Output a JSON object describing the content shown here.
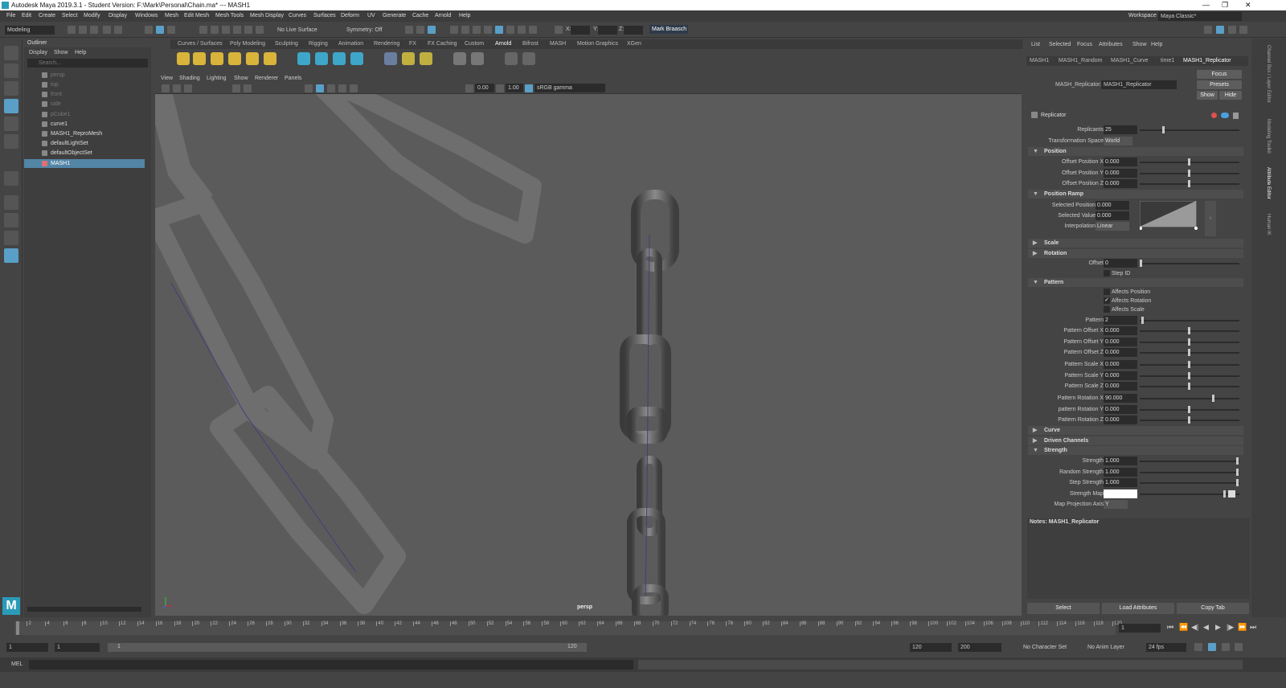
{
  "titlebar": {
    "title": "Autodesk Maya 2019.3.1 - Student Version: F:\\Mark\\Personal\\Chain.ma*   ---   MASH1",
    "min": "—",
    "max": "❐",
    "close": "✕"
  },
  "menu": [
    "File",
    "Edit",
    "Create",
    "Select",
    "Modify",
    "Display",
    "Windows",
    "Mesh",
    "Edit Mesh",
    "Mesh Tools",
    "Mesh Display",
    "Curves",
    "Surfaces",
    "Deform",
    "UV",
    "Generate",
    "Cache",
    "Arnold",
    "Help"
  ],
  "workspace": {
    "label": "Workspace :",
    "value": "Maya Classic*"
  },
  "status": {
    "mode": "Modeling",
    "live": "No Live Surface",
    "symmetry": "Symmetry: Off",
    "x_label": "X:",
    "y_label": "Y:",
    "z_label": "Z:",
    "user": "Mark Braasch"
  },
  "shelf_tabs": [
    "Curves / Surfaces",
    "Poly Modeling",
    "Sculpting",
    "Rigging",
    "Animation",
    "Rendering",
    "FX",
    "FX Caching",
    "Custom",
    "Arnold",
    "Bifrost",
    "MASH",
    "Motion Graphics",
    "XGen"
  ],
  "shelf_active": "Arnold",
  "outliner": {
    "title": "Outliner",
    "menu": [
      "Display",
      "Show",
      "Help"
    ],
    "search": "Search...",
    "items": [
      {
        "label": "persp",
        "dim": true
      },
      {
        "label": "top",
        "dim": true
      },
      {
        "label": "front",
        "dim": true
      },
      {
        "label": "side",
        "dim": true
      },
      {
        "label": "pCube1",
        "dim": true
      },
      {
        "label": "curve1",
        "dim": false
      },
      {
        "label": "MASH1_ReproMesh",
        "dim": false
      },
      {
        "label": "defaultLightSet",
        "dim": false
      },
      {
        "label": "defaultObjectSet",
        "dim": false
      },
      {
        "label": "MASH1",
        "dim": false,
        "selected": true
      }
    ]
  },
  "viewport": {
    "menu": [
      "View",
      "Shading",
      "Lighting",
      "Show",
      "Renderer",
      "Panels"
    ],
    "exposure": "0.00",
    "gamma": "1.00",
    "colorspace": "sRGB gamma",
    "camera": "persp"
  },
  "attr_editor": {
    "menu": [
      "List",
      "Selected",
      "Focus",
      "Attributes",
      "Show",
      "Help"
    ],
    "tabs": [
      "MASH1",
      "MASH1_Random",
      "MASH1_Curve",
      "time1",
      "MASH1_Replicator"
    ],
    "active_tab": "MASH1_Replicator",
    "node_label": "MASH_Replicator:",
    "node_value": "MASH1_Replicator",
    "btn_focus": "Focus",
    "btn_presets": "Presets",
    "btn_show": "Show",
    "btn_hide": "Hide",
    "header": "Replicator",
    "replicants_label": "Replicants",
    "replicants": "25",
    "space_label": "Transformation Space",
    "space": "World",
    "sec_position": "Position",
    "offx_label": "Offset Position X",
    "offx": "0.000",
    "offy_label": "Offset Position Y",
    "offy": "0.000",
    "offz_label": "Offset Position Z",
    "offz": "0.000",
    "sec_ramp": "Position Ramp",
    "selpos_label": "Selected Position",
    "selpos": "0.000",
    "selval_label": "Selected Value",
    "selval": "0.000",
    "interp_label": "Interpolation",
    "interp": "Linear",
    "sec_scale": "Scale",
    "sec_rotation": "Rotation",
    "offset_label": "Offset",
    "offset": "0",
    "stepid_label": "Step ID",
    "sec_pattern": "Pattern",
    "aff_pos": "Affects Position",
    "aff_pos_checked": false,
    "aff_rot": "Affects Rotation",
    "aff_rot_checked": true,
    "aff_scale": "Affects Scale",
    "aff_scale_checked": false,
    "pattern_label": "Pattern",
    "pattern": "2",
    "pox_label": "Pattern Offset X",
    "pox": "0.000",
    "poy_label": "Pattern Offset Y",
    "poy": "0.000",
    "poz_label": "Pattern Offset Z",
    "poz": "0.000",
    "psx_label": "Pattern Scale X",
    "psx": "0.000",
    "psy_label": "Pattern Scale Y",
    "psy": "0.000",
    "psz_label": "Pattern Scale Z",
    "psz": "0.000",
    "prx_label": "Pattern Rotation X",
    "prx": "90.000",
    "pry_label": "pattern Rotation Y",
    "pry": "0.000",
    "prz_label": "Pattern Rotation Z",
    "prz": "0.000",
    "sec_curve": "Curve",
    "sec_driven": "Driven Channels",
    "sec_strength": "Strength",
    "str_label": "Strength",
    "str": "1.000",
    "rstr_label": "Random Strength",
    "rstr": "1.000",
    "sstr_label": "Step Strength",
    "sstr": "1.000",
    "smap_label": "Strength Map",
    "mpa_label": "Map Projection Axis",
    "mpa": "Y",
    "notes": "Notes: MASH1_Replicator",
    "bottom": [
      "Select",
      "Load Attributes",
      "Copy Tab"
    ]
  },
  "right_strip": [
    "Channel Box / Layer Editor",
    "Modeling Toolkit",
    "Attribute Editor",
    "Human IK"
  ],
  "timeline": {
    "ticks": [
      "1",
      "2",
      "4",
      "6",
      "8",
      "10",
      "12",
      "14",
      "16",
      "18",
      "20",
      "22",
      "24",
      "26",
      "28",
      "30",
      "32",
      "34",
      "36",
      "38",
      "40",
      "42",
      "44",
      "46",
      "48",
      "50",
      "52",
      "54",
      "56",
      "58",
      "60",
      "62",
      "64",
      "66",
      "68",
      "70",
      "72",
      "74",
      "76",
      "78",
      "80",
      "82",
      "84",
      "86",
      "88",
      "90",
      "92",
      "94",
      "96",
      "98",
      "100",
      "102",
      "104",
      "106",
      "108",
      "110",
      "112",
      "114",
      "116",
      "118",
      "120"
    ],
    "current": "1"
  },
  "range": {
    "start": "1",
    "start2": "1",
    "bar_start": "1",
    "bar_end": "120",
    "end": "120",
    "end2": "200",
    "charset": "No Character Set",
    "animlayer": "No Anim Layer",
    "fps": "24 fps"
  },
  "cmdline": {
    "label": "MEL"
  }
}
